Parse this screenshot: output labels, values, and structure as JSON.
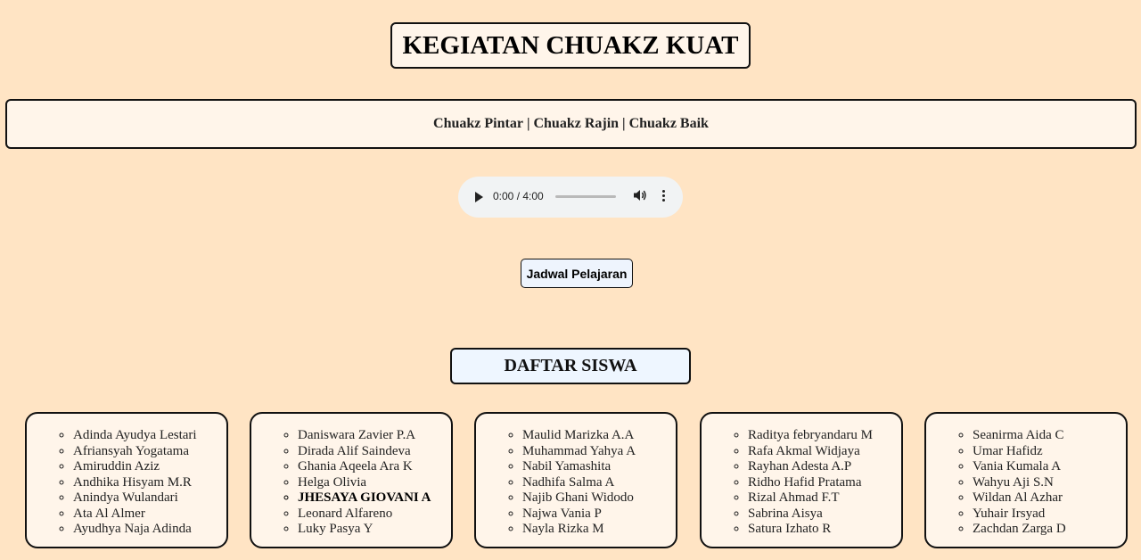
{
  "header": {
    "title": "KEGIATAN CHUAKZ KUAT"
  },
  "nav": {
    "items": [
      "Chuakz Pintar",
      "Chuakz Rajin",
      "Chuakz Baik"
    ],
    "separator": "|"
  },
  "audio": {
    "time": "0:00 / 4:00",
    "progress": 0
  },
  "schedule_button": {
    "label": "Jadwal Pelajaran"
  },
  "students_section": {
    "title": "DAFTAR SISWA"
  },
  "columns": [
    {
      "names": [
        "Adinda Ayudya Lestari",
        "Afriansyah Yogatama",
        "Amiruddin Aziz",
        "Andhika Hisyam M.R",
        "Anindya Wulandari",
        "Ata Al Almer",
        "Ayudhya Naja Adinda"
      ]
    },
    {
      "names": [
        "Daniswara Zavier P.A",
        "Dirada Alif Saindeva",
        "Ghania Aqeela Ara K",
        "Helga Olivia",
        "JHESAYA GIOVANI A",
        "Leonard Alfareno",
        "Luky Pasya Y"
      ]
    },
    {
      "names": [
        "Maulid Marizka A.A",
        "Muhammad Yahya A",
        "Nabil Yamashita",
        "Nadhifa Salma A",
        "Najib Ghani Widodo",
        "Najwa Vania P",
        "Nayla Rizka M"
      ]
    },
    {
      "names": [
        "Raditya febryandaru M",
        "Rafa Akmal Widjaya",
        "Rayhan Adesta A.P",
        "Ridho Hafid Pratama",
        "Rizal Ahmad F.T",
        "Sabrina Aisya",
        "Satura Izhato R"
      ]
    },
    {
      "names": [
        "Seanirma Aida C",
        "Umar Hafidz",
        "Vania Kumala A",
        "Wahyu Aji S.N",
        "Wildan Al Azhar",
        "Yuhair Irsyad",
        "Zachdan Zarga D"
      ]
    }
  ]
}
